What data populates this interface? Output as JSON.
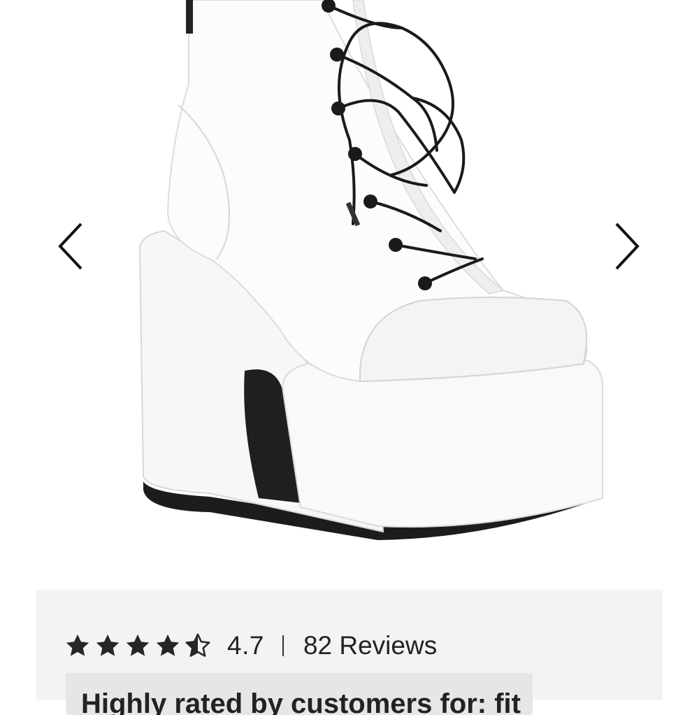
{
  "product": {
    "image_alt": "White platform lace-up ankle boot",
    "colors": {
      "boot": "#fafafa",
      "sole": "#1c1c1c",
      "laces": "#1a1a1a"
    }
  },
  "gallery": {
    "prev_icon": "chevron-left-icon",
    "next_icon": "chevron-right-icon"
  },
  "reviews": {
    "rating": 4.7,
    "rating_label": "4.7",
    "count_label": "82 Reviews",
    "snippet": "Highly rated by customers for: fit",
    "star_icons": [
      "star-full-icon",
      "star-full-icon",
      "star-full-icon",
      "star-full-icon",
      "star-half-icon"
    ]
  },
  "theme": {
    "panel_bg": "#f3f3f3",
    "text": "#222222"
  }
}
